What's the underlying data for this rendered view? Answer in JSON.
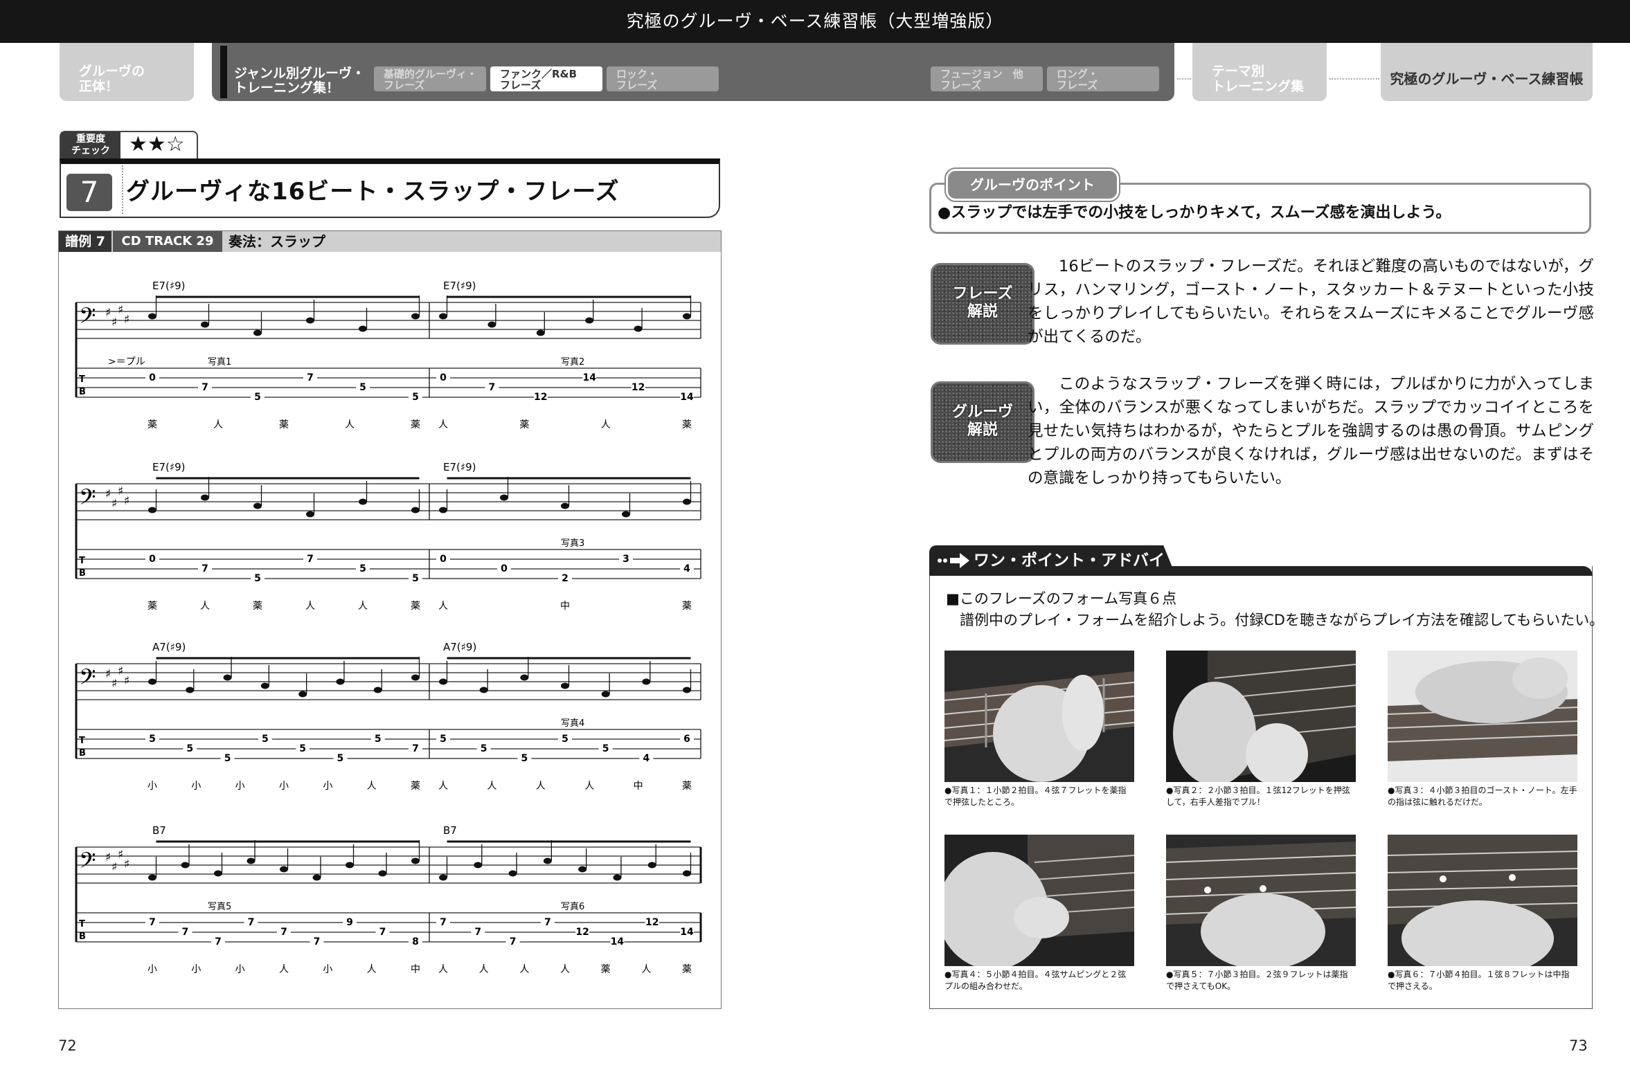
{
  "header": {
    "title": "究極のグルーヴ・ベース練習帳（大型増強版）"
  },
  "nav": {
    "left": "グルーヴの\n正体！",
    "section": "ジャンル別グルーヴ・\nトレーニング集！",
    "tabs": [
      "基礎的グルーヴィ・\nフレーズ",
      "ファンク／R&B\nフレーズ",
      "ロック・\nフレーズ",
      "フュージョン　他\nフレーズ",
      "ロング・\nフレーズ"
    ],
    "theme": "テーマ別\nトレーニング集",
    "book": "究極のグルーヴ・ベース練習帳"
  },
  "importance": {
    "label": "重要度\nチェック",
    "stars": "★★☆"
  },
  "lesson": {
    "number": "7",
    "title": "グルーヴィな16ビート・スラップ・フレーズ"
  },
  "score": {
    "example": "譜例 7",
    "track": "CD TRACK 29",
    "technique": "奏法：スラップ",
    "legend": ">＝プル",
    "systems": [
      {
        "chords": [
          "E7(♯9)",
          "E7(♯9)"
        ],
        "tab": [
          [
            "0",
            "7",
            "5",
            "7",
            "5",
            "5"
          ],
          [
            "0",
            "7",
            "12",
            "14",
            "12",
            "14"
          ]
        ],
        "fingers": [
          [
            "薬",
            "人",
            "薬",
            "人",
            "薬"
          ],
          [
            "人",
            "薬",
            "人",
            "薬"
          ]
        ],
        "photos": [
          "写真1",
          "写真2"
        ]
      },
      {
        "chords": [
          "E7(♯9)",
          "E7(♯9)"
        ],
        "tab": [
          [
            "0",
            "7",
            "5",
            "7",
            "5",
            "5"
          ],
          [
            "0",
            "0",
            "2",
            "3",
            "4"
          ]
        ],
        "fingers": [
          [
            "薬",
            "人",
            "薬",
            "人",
            "人",
            "薬"
          ],
          [
            "人",
            "中",
            "薬"
          ]
        ],
        "photos": [
          "写真3"
        ]
      },
      {
        "chords": [
          "A7(♯9)",
          "A7(♯9)"
        ],
        "tab": [
          [
            "5",
            "5",
            "5",
            "5",
            "5",
            "5",
            "5",
            "7"
          ],
          [
            "5",
            "5",
            "5",
            "5",
            "5",
            "4",
            "6"
          ]
        ],
        "fingers": [
          [
            "小",
            "小",
            "小",
            "小",
            "小",
            "人",
            "薬"
          ],
          [
            "人",
            "人",
            "人",
            "人",
            "中",
            "薬"
          ]
        ],
        "photos": [
          "写真4"
        ]
      },
      {
        "chords": [
          "B7",
          "B7"
        ],
        "tab": [
          [
            "7",
            "7",
            "7",
            "7",
            "7",
            "7",
            "9",
            "7",
            "8"
          ],
          [
            "7",
            "7",
            "7",
            "7",
            "12",
            "14",
            "12",
            "14"
          ]
        ],
        "fingers": [
          [
            "小",
            "小",
            "小",
            "人",
            "小",
            "人",
            "中"
          ],
          [
            "人",
            "人",
            "人",
            "人",
            "薬",
            "人",
            "薬"
          ]
        ],
        "photos": [
          "写真5",
          "写真6"
        ]
      }
    ]
  },
  "point": {
    "tab": "グルーヴのポイント",
    "text": "●スラップでは左手での小技をしっかりキメて，スムーズ感を演出しよう。"
  },
  "phrase": {
    "badge": "フレーズ\n解説",
    "text": "16ビートのスラップ・フレーズだ。それほど難度の高いものではないが，グリス，ハンマリング，ゴースト・ノート，スタッカート＆テヌートといった小技をしっかりプレイしてもらいたい。それらをスムーズにキメることでグルーヴ感が出てくるのだ。"
  },
  "groove": {
    "badge": "グルーヴ\n解説",
    "text": "このようなスラップ・フレーズを弾く時には，プルばかりに力が入ってしまい，全体のバランスが悪くなってしまいがちだ。スラップでカッコイイところを見せたい気持ちはわかるが，やたらとプルを強調するのは愚の骨頂。サムピングとプルの両方のバランスが良くなければ，グルーヴ感は出せないのだ。まずはその意識をしっかり持ってもらいたい。"
  },
  "advice": {
    "tab": "ワン・ポイント・アドバイス",
    "heading": "■このフレーズのフォーム写真６点",
    "sub": "譜例中のプレイ・フォームを紹介しよう。付録CDを聴きながらプレイ方法を確認してもらいたい。",
    "photos": [
      {
        "caption": "●写真１：１小節２拍目。４弦７フレットを薬指で押弦したところ。"
      },
      {
        "caption": "●写真２：２小節３拍目。１弦12フレットを押弦して，右手人差指でプル！"
      },
      {
        "caption": "●写真３：４小節３拍目のゴースト・ノート。左手の指は弦に触れるだけだ。"
      },
      {
        "caption": "●写真４：５小節４拍目。４弦サムピングと２弦プルの組み合わせだ。"
      },
      {
        "caption": "●写真５：７小節３拍目。２弦９フレットは薬指で押さえてもOK。"
      },
      {
        "caption": "●写真６：７小節４拍目。１弦８フレットは中指で押さえる。"
      }
    ]
  },
  "pages": {
    "left": "72",
    "right": "73"
  }
}
